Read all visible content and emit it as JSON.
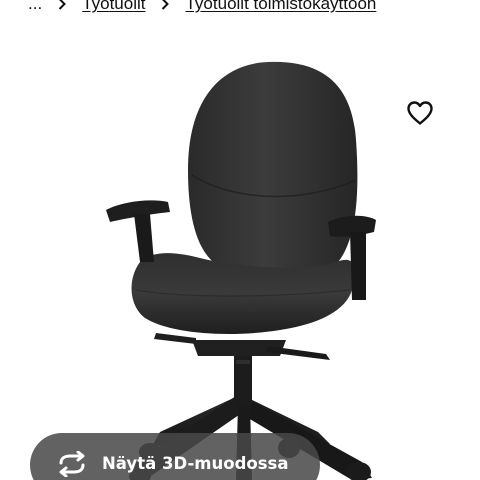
{
  "breadcrumb": {
    "ellipsis": "...",
    "items": [
      {
        "label": "Työtuolit"
      },
      {
        "label": "Työtuolit toimistokäyttöön"
      }
    ]
  },
  "product": {
    "image_alt": "office-chair-product-image"
  },
  "actions": {
    "view_3d_label": "Näytä 3D-muodossa"
  },
  "icons": {
    "favourite": "heart-outline-icon",
    "view_3d": "rotate-arrows-icon",
    "separator": "chevron-right-icon"
  },
  "colors": {
    "text": "#111111",
    "overlay_button": "#484848",
    "chair_dark": "#2b2b2b"
  }
}
